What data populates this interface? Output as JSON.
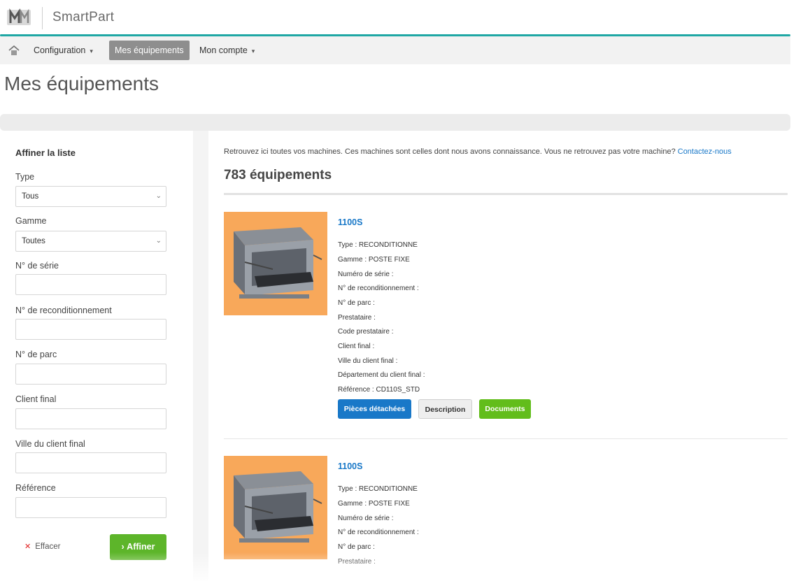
{
  "header": {
    "app_name": "SmartPart"
  },
  "nav": {
    "items": [
      {
        "label": "Configuration",
        "has_caret": true
      },
      {
        "label": "Mes équipements",
        "active": true
      },
      {
        "label": "Mon compte",
        "has_caret": true
      }
    ]
  },
  "page": {
    "title": "Mes équipements"
  },
  "sidebar": {
    "title": "Affiner la liste",
    "type_label": "Type",
    "type_value": "Tous",
    "gamme_label": "Gamme",
    "gamme_value": "Toutes",
    "serial_label": "N° de série",
    "recond_label": "N° de reconditionnement",
    "parc_label": "N° de parc",
    "client_label": "Client final",
    "ville_label": "Ville du client final",
    "ref_label": "Référence",
    "clear_label": "Effacer",
    "refine_label": "Affiner"
  },
  "main": {
    "intro_text": "Retrouvez ici toutes vos machines. Ces machines sont celles dont nous avons connaissance. Vous ne retrouvez pas votre machine?",
    "contact_link": "Contactez-nous",
    "count": "783 équipements",
    "cards": [
      {
        "title": "1100S",
        "fields": [
          "Type : RECONDITIONNE",
          "Gamme : POSTE FIXE",
          "Numéro de série :",
          "N° de reconditionnement :",
          "N° de parc :",
          "Prestataire :",
          "Code prestataire :",
          "Client final :",
          "Ville du client final :",
          "Département du client final :",
          "Référence : CD110S_STD"
        ],
        "btn_parts": "Pièces détachées",
        "btn_desc": "Description",
        "btn_docs": "Documents"
      },
      {
        "title": "1100S",
        "fields": [
          "Type : RECONDITIONNE",
          "Gamme : POSTE FIXE",
          "Numéro de série :",
          "N° de reconditionnement :",
          "N° de parc :",
          "Prestataire :"
        ]
      }
    ]
  },
  "colors": {
    "accent_teal": "#1fa7a4",
    "link_blue": "#1978c8",
    "green": "#5db52a",
    "image_bg": "#f8a85a"
  },
  "icons": [
    "logo-icon",
    "home-icon",
    "chevron-down-icon",
    "clear-x-icon",
    "chevron-right-icon",
    "machine-image"
  ]
}
